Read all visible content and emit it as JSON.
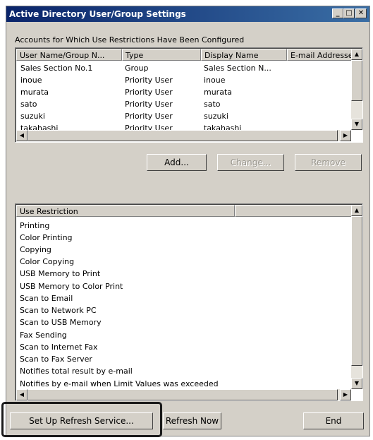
{
  "window": {
    "title": "Active Directory User/Group Settings",
    "controls": {
      "minimize": "_",
      "maximize": "□",
      "close": "✕"
    }
  },
  "accounts": {
    "label": "Accounts for Which Use Restrictions Have Been Configured",
    "columns": [
      "User Name/Group N...",
      "Type",
      "Display Name",
      "E-mail Addresses"
    ],
    "rows": [
      [
        "Sales Section No.1",
        "Group",
        "Sales Section N...",
        ""
      ],
      [
        "inoue",
        "Priority User",
        "inoue",
        ""
      ],
      [
        "murata",
        "Priority User",
        "murata",
        ""
      ],
      [
        "sato",
        "Priority User",
        "sato",
        ""
      ],
      [
        "suzuki",
        "Priority User",
        "suzuki",
        ""
      ],
      [
        "takahashi",
        "Priority User",
        "takahashi",
        ""
      ]
    ]
  },
  "buttons": {
    "add": "Add...",
    "change": "Change...",
    "remove": "Remove",
    "setup_refresh": "Set Up Refresh Service...",
    "refresh_now": "Refresh Now",
    "end": "End"
  },
  "restrictions": {
    "header": "Use Restriction",
    "items": [
      "Printing",
      "Color Printing",
      "Copying",
      "Color Copying",
      "USB Memory to Print",
      "USB Memory to Color Print",
      "Scan to Email",
      "Scan to Network PC",
      "Scan to USB Memory",
      "Fax Sending",
      "Scan to Internet Fax",
      "Scan to Fax Server",
      "Notifies total result by e-mail",
      "Notifies by e-mail when Limit Values was exceeded"
    ]
  },
  "icons": {
    "scroll_up": "▲",
    "scroll_down": "▼",
    "scroll_left": "◀",
    "scroll_right": "▶"
  }
}
